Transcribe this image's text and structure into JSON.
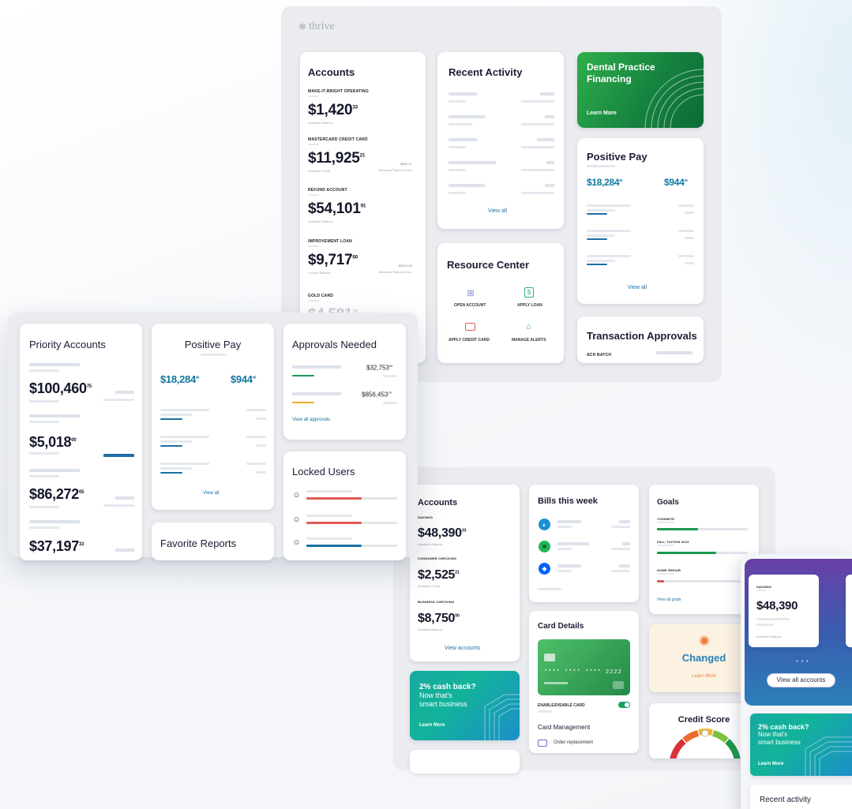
{
  "brand": {
    "name": "thrive",
    "colors": {
      "accent": "#1d6fa5",
      "green": "#1a9a4e",
      "teal": "#13a59a"
    }
  },
  "desktop": {
    "accounts": {
      "title": "Accounts",
      "items": [
        {
          "name": "MAKE-IT-BRIGHT OPERATING",
          "whole": "$1,420",
          "cents": "33",
          "sub": "Available Balance"
        },
        {
          "name": "MASTERCARD CREDIT CARD",
          "whole": "$11,925",
          "cents": "21",
          "sub": "Available Credit",
          "side": "$300.11",
          "side_sub": "Minimum Payment Due"
        },
        {
          "name": "REFUND ACCOUNT",
          "whole": "$54,101",
          "cents": "91",
          "sub": "Available Balance"
        },
        {
          "name": "IMPROVEMENT LOAN",
          "whole": "$9,717",
          "cents": "60",
          "sub": "Current Balance",
          "side": "$2012.05",
          "side_sub": "Minimum Payment Due"
        },
        {
          "name": "GOLD CARD",
          "whole": "$4,581",
          "cents": "22"
        }
      ]
    },
    "recent_activity": {
      "title": "Recent Activity",
      "link": "View all"
    },
    "promo": {
      "title": "Dental Practice Financing",
      "cta": "Learn More"
    },
    "positive_pay": {
      "title": "Positive Pay",
      "amount1": "$18,284",
      "amount1_cents": "40",
      "amount2": "$944",
      "amount2_cents": "40",
      "link": "View all"
    },
    "resource_center": {
      "title": "Resource Center",
      "items": [
        "OPEN ACCOUNT",
        "APPLY LOAN",
        "APPLY CREDIT CARD",
        "MANAGE ALERTS"
      ]
    },
    "transaction_approvals": {
      "title": "Transaction Approvals",
      "first_row": "ACH BATCH"
    }
  },
  "business": {
    "priority": {
      "title": "Priority Accounts",
      "items": [
        {
          "whole": "$100,460",
          "cents": "75"
        },
        {
          "whole": "$5,018",
          "cents": "00"
        },
        {
          "whole": "$86,272",
          "cents": "05"
        },
        {
          "whole": "$37,197",
          "cents": "33"
        }
      ]
    },
    "positive_pay": {
      "title": "Positive Pay",
      "amount1": "$18,284",
      "amount1_cents": "40",
      "amount2": "$944",
      "amount2_cents": "40",
      "link": "View all"
    },
    "approvals": {
      "title": "Approvals Needed",
      "items": [
        {
          "amount": "$32,753",
          "cents": "90"
        },
        {
          "amount": "$856,453",
          "cents": "79"
        }
      ],
      "link": "View all approvals"
    },
    "locked_users": {
      "title": "Locked Users"
    },
    "favorite_reports": {
      "title": "Favorite Reports"
    }
  },
  "personal": {
    "accounts": {
      "title": "Accounts",
      "items": [
        {
          "name": "SAVINGS",
          "whole": "$48,390",
          "cents": "33",
          "sub": "Available Balance"
        },
        {
          "name": "CONSUMER CHECKING",
          "whole": "$2,525",
          "cents": "21",
          "sub": "Available Credit"
        },
        {
          "name": "BUSINESS CHECKING",
          "whole": "$8,750",
          "cents": "00",
          "sub": "Available Balance"
        }
      ],
      "link": "View accounts"
    },
    "bills": {
      "title": "Bills this week"
    },
    "goals": {
      "title": "Goals",
      "items": [
        {
          "name": "YOSEMITE",
          "progress": 0.45
        },
        {
          "name": "FALL TUITION 2024",
          "progress": 0.65
        },
        {
          "name": "HOME REPAIR",
          "progress": 0.08
        }
      ],
      "link": "View all goals"
    },
    "card_details": {
      "title": "Card Details",
      "card_number": "**** **** **** 2222",
      "toggle_label": "ENABLE/DISABLE CARD",
      "mgmt_title": "Card Management",
      "mgmt_item": "Order replacement"
    },
    "changed": {
      "title": "Changed",
      "cta": "Learn More"
    },
    "credit_score": {
      "title": "Credit Score"
    },
    "cashback": {
      "line1": "2% cash back?",
      "line2": "Now that's",
      "line3": "smart business",
      "cta": "Learn More"
    }
  },
  "mobile": {
    "account": {
      "name": "SAVINGS",
      "amount": "$48,390",
      "sub": "Available Balance"
    },
    "button": "View all accounts",
    "cashback": {
      "line1": "2% cash back?",
      "line2": "Now that's",
      "line3": "smart business",
      "cta": "Learn More"
    },
    "recent": {
      "title": "Recent activity"
    }
  }
}
